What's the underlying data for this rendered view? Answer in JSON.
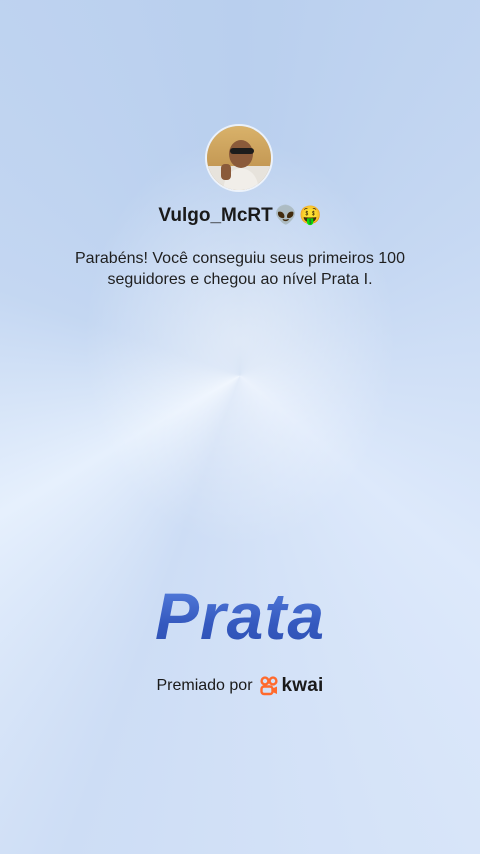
{
  "profile": {
    "avatar_alt": "Vulgo_McRT",
    "username": "Vulgo_McRT",
    "username_emojis": [
      "👽",
      "🤑"
    ]
  },
  "message": "Parabéns! Você conseguiu seus primeiros 100 seguidores e chegou ao nível Prata I.",
  "level": {
    "title": "Prata"
  },
  "award": {
    "label": "Premiado por",
    "brand": "kwai",
    "brand_color": "#ff6a2c"
  },
  "colors": {
    "level_title": "#3a63c9",
    "text": "#1a1a1a"
  }
}
